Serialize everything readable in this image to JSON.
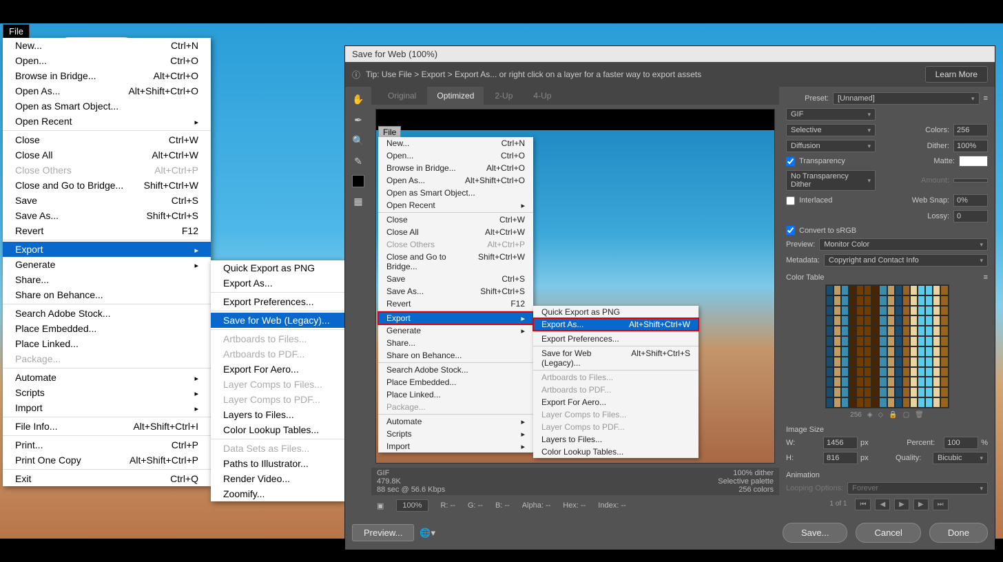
{
  "app": {
    "file_tab": "File"
  },
  "menu_left": [
    {
      "label": "New...",
      "shortcut": "Ctrl+N"
    },
    {
      "label": "Open...",
      "shortcut": "Ctrl+O"
    },
    {
      "label": "Browse in Bridge...",
      "shortcut": "Alt+Ctrl+O"
    },
    {
      "label": "Open As...",
      "shortcut": "Alt+Shift+Ctrl+O"
    },
    {
      "label": "Open as Smart Object..."
    },
    {
      "label": "Open Recent",
      "arrow": true
    },
    {
      "sep": true
    },
    {
      "label": "Close",
      "shortcut": "Ctrl+W"
    },
    {
      "label": "Close All",
      "shortcut": "Alt+Ctrl+W"
    },
    {
      "label": "Close Others",
      "shortcut": "Alt+Ctrl+P",
      "disabled": true
    },
    {
      "label": "Close and Go to Bridge...",
      "shortcut": "Shift+Ctrl+W"
    },
    {
      "label": "Save",
      "shortcut": "Ctrl+S"
    },
    {
      "label": "Save As...",
      "shortcut": "Shift+Ctrl+S"
    },
    {
      "label": "Revert",
      "shortcut": "F12"
    },
    {
      "sep": true
    },
    {
      "label": "Export",
      "arrow": true,
      "highlight": true
    },
    {
      "label": "Generate",
      "arrow": true
    },
    {
      "label": "Share..."
    },
    {
      "label": "Share on Behance..."
    },
    {
      "sep": true
    },
    {
      "label": "Search Adobe Stock..."
    },
    {
      "label": "Place Embedded..."
    },
    {
      "label": "Place Linked..."
    },
    {
      "label": "Package...",
      "disabled": true
    },
    {
      "sep": true
    },
    {
      "label": "Automate",
      "arrow": true
    },
    {
      "label": "Scripts",
      "arrow": true
    },
    {
      "label": "Import",
      "arrow": true
    },
    {
      "sep": true
    },
    {
      "label": "File Info...",
      "shortcut": "Alt+Shift+Ctrl+I"
    },
    {
      "sep": true
    },
    {
      "label": "Print...",
      "shortcut": "Ctrl+P"
    },
    {
      "label": "Print One Copy",
      "shortcut": "Alt+Shift+Ctrl+P"
    },
    {
      "sep": true
    },
    {
      "label": "Exit",
      "shortcut": "Ctrl+Q"
    }
  ],
  "submenu_left": [
    {
      "label": "Quick Export as PNG"
    },
    {
      "label": "Export As..."
    },
    {
      "sep": true
    },
    {
      "label": "Export Preferences..."
    },
    {
      "sep": true
    },
    {
      "label": "Save for Web (Legacy)...",
      "highlight": true
    },
    {
      "sep": true
    },
    {
      "label": "Artboards to Files...",
      "disabled": true
    },
    {
      "label": "Artboards to PDF...",
      "disabled": true
    },
    {
      "label": "Export For Aero..."
    },
    {
      "label": "Layer Comps to Files...",
      "disabled": true
    },
    {
      "label": "Layer Comps to PDF...",
      "disabled": true
    },
    {
      "label": "Layers to Files..."
    },
    {
      "label": "Color Lookup Tables..."
    },
    {
      "sep": true
    },
    {
      "label": "Data Sets as Files...",
      "disabled": true
    },
    {
      "label": "Paths to Illustrator..."
    },
    {
      "label": "Render Video..."
    },
    {
      "label": "Zoomify..."
    }
  ],
  "dialog": {
    "title": "Save for Web (100%)",
    "tip": "Tip: Use File > Export > Export As...   or right click on a layer for a faster way to export assets",
    "learn_more": "Learn More",
    "tabs": [
      "Original",
      "Optimized",
      "2-Up",
      "4-Up"
    ],
    "active_tab": "Optimized",
    "preview_info_left": [
      "GIF",
      "479.8K",
      "88 sec @ 56.6 Kbps"
    ],
    "preview_info_right": [
      "100% dither",
      "Selective palette",
      "256 colors"
    ],
    "zoom": "100%",
    "readouts": {
      "r": "R: --",
      "g": "G: --",
      "b": "B: --",
      "alpha": "Alpha: --",
      "hex": "Hex: --",
      "index": "Index: --"
    },
    "preview_btn": "Preview...",
    "save": "Save...",
    "cancel": "Cancel",
    "done": "Done"
  },
  "menu2": [
    {
      "label": "New...",
      "shortcut": "Ctrl+N"
    },
    {
      "label": "Open...",
      "shortcut": "Ctrl+O"
    },
    {
      "label": "Browse in Bridge...",
      "shortcut": "Alt+Ctrl+O"
    },
    {
      "label": "Open As...",
      "shortcut": "Alt+Shift+Ctrl+O"
    },
    {
      "label": "Open as Smart Object..."
    },
    {
      "label": "Open Recent",
      "arrow": true
    },
    {
      "sep": true
    },
    {
      "label": "Close",
      "shortcut": "Ctrl+W"
    },
    {
      "label": "Close All",
      "shortcut": "Alt+Ctrl+W"
    },
    {
      "label": "Close Others",
      "shortcut": "Alt+Ctrl+P",
      "disabled": true
    },
    {
      "label": "Close and Go to Bridge...",
      "shortcut": "Shift+Ctrl+W"
    },
    {
      "label": "Save",
      "shortcut": "Ctrl+S"
    },
    {
      "label": "Save As...",
      "shortcut": "Shift+Ctrl+S"
    },
    {
      "label": "Revert",
      "shortcut": "F12"
    },
    {
      "sep": true
    },
    {
      "label": "Export",
      "arrow": true,
      "highlight": true,
      "red": true
    },
    {
      "label": "Generate",
      "arrow": true
    },
    {
      "label": "Share..."
    },
    {
      "label": "Share on Behance..."
    },
    {
      "sep": true
    },
    {
      "label": "Search Adobe Stock..."
    },
    {
      "label": "Place Embedded..."
    },
    {
      "label": "Place Linked..."
    },
    {
      "label": "Package...",
      "disabled": true
    },
    {
      "sep": true
    },
    {
      "label": "Automate",
      "arrow": true
    },
    {
      "label": "Scripts",
      "arrow": true
    },
    {
      "label": "Import",
      "arrow": true
    }
  ],
  "submenu2": [
    {
      "label": "Quick Export as PNG"
    },
    {
      "label": "Export As...",
      "shortcut": "Alt+Shift+Ctrl+W",
      "red": true
    },
    {
      "sep": true
    },
    {
      "label": "Export Preferences..."
    },
    {
      "sep": true
    },
    {
      "label": "Save for Web (Legacy)...",
      "shortcut": "Alt+Shift+Ctrl+S"
    },
    {
      "sep": true
    },
    {
      "label": "Artboards to Files...",
      "disabled": true
    },
    {
      "label": "Artboards to PDF...",
      "disabled": true
    },
    {
      "label": "Export For Aero..."
    },
    {
      "label": "Layer Comps to Files...",
      "disabled": true
    },
    {
      "label": "Layer Comps to PDF...",
      "disabled": true
    },
    {
      "label": "Layers to Files..."
    },
    {
      "label": "Color Lookup Tables..."
    }
  ],
  "settings": {
    "preset_label": "Preset:",
    "preset_value": "[Unnamed]",
    "format": "GIF",
    "reduction": "Selective",
    "colors_label": "Colors:",
    "colors": "256",
    "dither_method": "Diffusion",
    "dither_label": "Dither:",
    "dither": "100%",
    "transparency_label": "Transparency",
    "matte_label": "Matte:",
    "trans_dither": "No Transparency Dither",
    "amount_label": "Amount:",
    "interlaced_label": "Interlaced",
    "websnap_label": "Web Snap:",
    "websnap": "0%",
    "lossy_label": "Lossy:",
    "lossy": "0",
    "srgb_label": "Convert to sRGB",
    "preview_label": "Preview:",
    "preview_value": "Monitor Color",
    "metadata_label": "Metadata:",
    "metadata_value": "Copyright and Contact Info",
    "color_table_label": "Color Table",
    "color_count": "256",
    "image_size_label": "Image Size",
    "w_label": "W:",
    "w": "1456",
    "h_label": "H:",
    "h": "816",
    "px": "px",
    "percent_label": "Percent:",
    "percent": "100",
    "percent_sym": "%",
    "quality_label": "Quality:",
    "quality": "Bicubic",
    "animation_label": "Animation",
    "loop_label": "Looping Options:",
    "loop": "Forever",
    "frame": "1 of 1"
  }
}
